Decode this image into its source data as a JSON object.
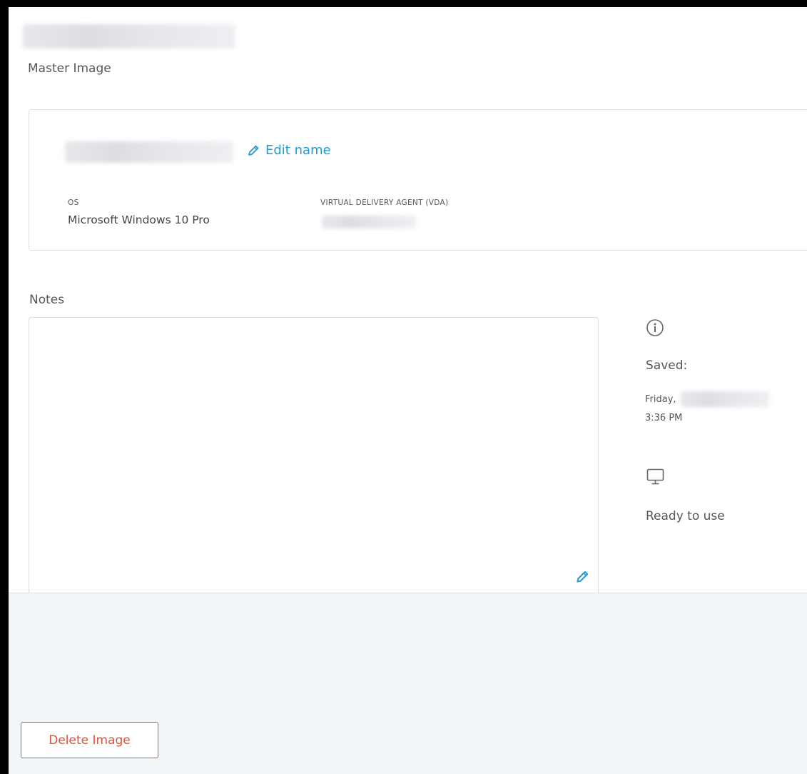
{
  "header": {
    "subtitle": "Master Image"
  },
  "card": {
    "edit_link_label": "Edit name",
    "os_label": "OS",
    "os_value": "Microsoft Windows 10 Pro",
    "vda_label": "VIRTUAL DELIVERY AGENT (VDA)"
  },
  "notes": {
    "label": "Notes",
    "value": ""
  },
  "status": {
    "saved_label": "Saved:",
    "saved_day": "Friday,",
    "saved_time": "3:36 PM",
    "ready_text": "Ready to use"
  },
  "footer": {
    "delete_label": "Delete Image"
  },
  "colors": {
    "link": "#1f9ad6",
    "danger": "#d9523a",
    "footer_bg": "#f3f6f9"
  },
  "icons": {
    "edit": "pencil-icon",
    "info": "info-circle-icon",
    "monitor": "monitor-icon"
  }
}
